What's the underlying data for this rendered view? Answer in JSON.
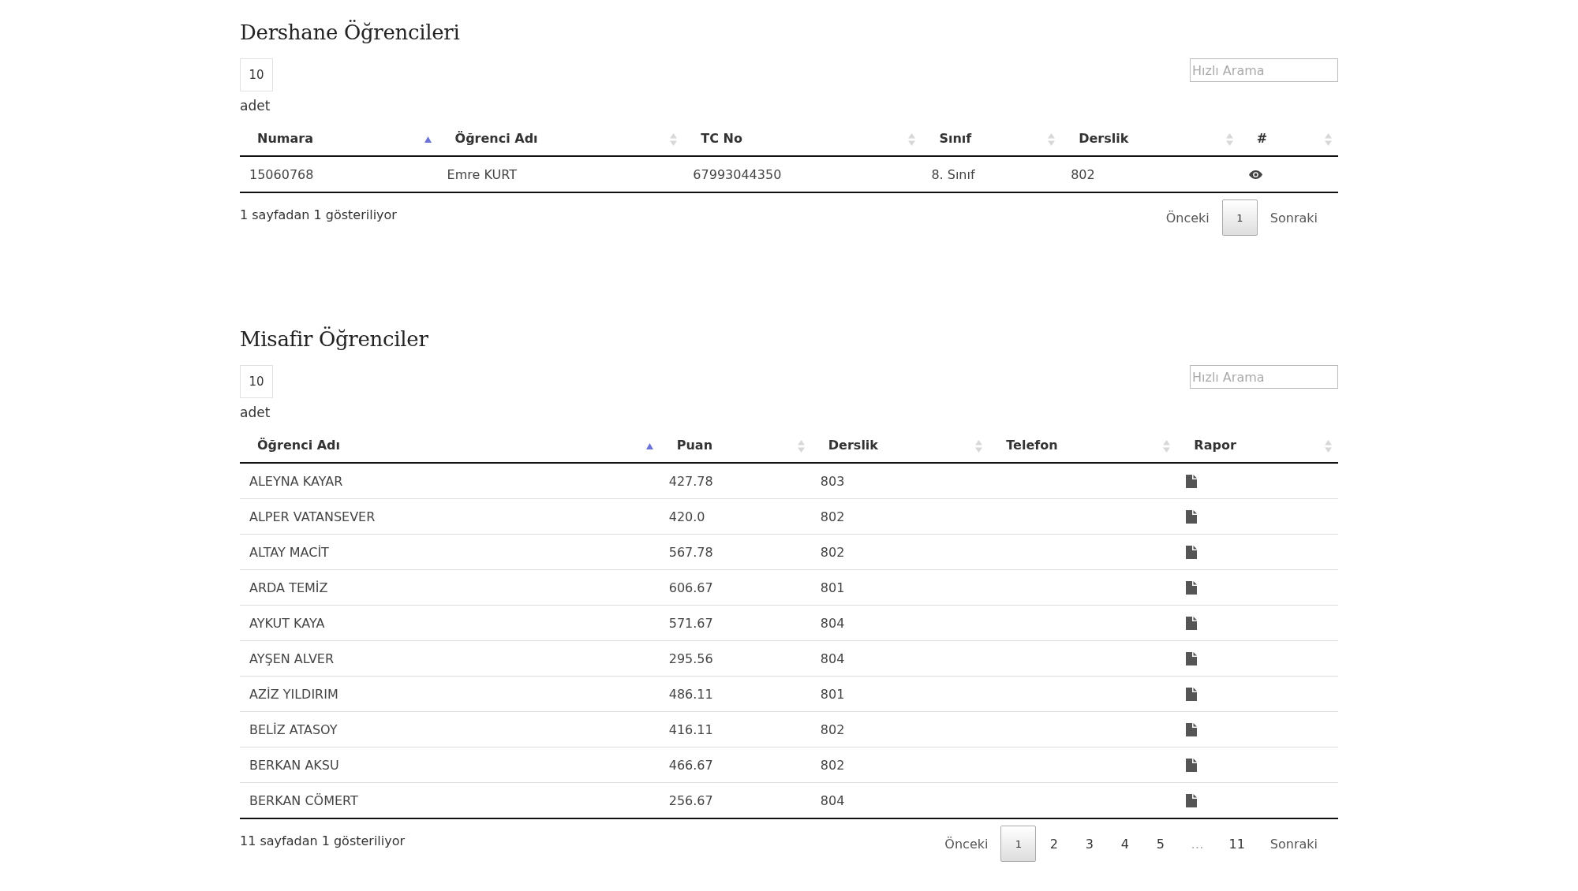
{
  "sections": [
    {
      "title": "Dershane Öğrencileri",
      "length": "10",
      "length_label": "adet",
      "search": {
        "placeholder": "Hızlı Arama"
      },
      "columns": [
        {
          "label": "Numara",
          "sorted": true
        },
        {
          "label": "Öğrenci Adı",
          "sorted": false
        },
        {
          "label": "TC No",
          "sorted": false
        },
        {
          "label": "Sınıf",
          "sorted": false
        },
        {
          "label": "Derslik",
          "sorted": false
        },
        {
          "label": "#",
          "sorted": false
        }
      ],
      "rows": [
        {
          "cells": [
            {
              "kind": "text",
              "text": "15060768"
            },
            {
              "kind": "text",
              "text": "Emre KURT"
            },
            {
              "kind": "text",
              "text": "67993044350"
            },
            {
              "kind": "text",
              "text": "8. Sınıf"
            },
            {
              "kind": "text",
              "text": "802"
            },
            {
              "kind": "eye"
            }
          ]
        }
      ],
      "info": "1 sayfadan 1 gösteriliyor",
      "pagination": [
        {
          "label": "Önceki",
          "kind": "nav",
          "selected": false
        },
        {
          "label": "1",
          "kind": "page",
          "selected": true
        },
        {
          "label": "Sonraki",
          "kind": "nav",
          "selected": false
        }
      ]
    },
    {
      "title": "Misafir Öğrenciler",
      "length": "10",
      "length_label": "adet",
      "search": {
        "placeholder": "Hızlı Arama"
      },
      "columns": [
        {
          "label": "Öğrenci Adı",
          "sorted": true
        },
        {
          "label": "Puan",
          "sorted": false
        },
        {
          "label": "Derslik",
          "sorted": false
        },
        {
          "label": "Telefon",
          "sorted": false
        },
        {
          "label": "Rapor",
          "sorted": false
        }
      ],
      "rows": [
        {
          "cells": [
            {
              "kind": "text",
              "text": "ALEYNA KAYAR"
            },
            {
              "kind": "text",
              "text": "427.78"
            },
            {
              "kind": "text",
              "text": "803"
            },
            {
              "kind": "empty"
            },
            {
              "kind": "file"
            }
          ]
        },
        {
          "cells": [
            {
              "kind": "text",
              "text": "ALPER VATANSEVER"
            },
            {
              "kind": "text",
              "text": "420.0"
            },
            {
              "kind": "text",
              "text": "802"
            },
            {
              "kind": "empty"
            },
            {
              "kind": "file"
            }
          ]
        },
        {
          "cells": [
            {
              "kind": "text",
              "text": "ALTAY MACİT"
            },
            {
              "kind": "text",
              "text": "567.78"
            },
            {
              "kind": "text",
              "text": "802"
            },
            {
              "kind": "empty"
            },
            {
              "kind": "file"
            }
          ]
        },
        {
          "cells": [
            {
              "kind": "text",
              "text": "ARDA TEMİZ"
            },
            {
              "kind": "text",
              "text": "606.67"
            },
            {
              "kind": "text",
              "text": "801"
            },
            {
              "kind": "empty"
            },
            {
              "kind": "file"
            }
          ]
        },
        {
          "cells": [
            {
              "kind": "text",
              "text": "AYKUT KAYA"
            },
            {
              "kind": "text",
              "text": "571.67"
            },
            {
              "kind": "text",
              "text": "804"
            },
            {
              "kind": "empty"
            },
            {
              "kind": "file"
            }
          ]
        },
        {
          "cells": [
            {
              "kind": "text",
              "text": "AYŞEN ALVER"
            },
            {
              "kind": "text",
              "text": "295.56"
            },
            {
              "kind": "text",
              "text": "804"
            },
            {
              "kind": "empty"
            },
            {
              "kind": "file"
            }
          ]
        },
        {
          "cells": [
            {
              "kind": "text",
              "text": "AZİZ YILDIRIM"
            },
            {
              "kind": "text",
              "text": "486.11"
            },
            {
              "kind": "text",
              "text": "801"
            },
            {
              "kind": "empty"
            },
            {
              "kind": "file"
            }
          ]
        },
        {
          "cells": [
            {
              "kind": "text",
              "text": "BELİZ ATASOY"
            },
            {
              "kind": "text",
              "text": "416.11"
            },
            {
              "kind": "text",
              "text": "802"
            },
            {
              "kind": "empty"
            },
            {
              "kind": "file"
            }
          ]
        },
        {
          "cells": [
            {
              "kind": "text",
              "text": "BERKAN AKSU"
            },
            {
              "kind": "text",
              "text": "466.67"
            },
            {
              "kind": "text",
              "text": "802"
            },
            {
              "kind": "empty"
            },
            {
              "kind": "file"
            }
          ]
        },
        {
          "cells": [
            {
              "kind": "text",
              "text": "BERKAN CÖMERT"
            },
            {
              "kind": "text",
              "text": "256.67"
            },
            {
              "kind": "text",
              "text": "804"
            },
            {
              "kind": "empty"
            },
            {
              "kind": "file"
            }
          ]
        }
      ],
      "info": "11 sayfadan 1 gösteriliyor",
      "pagination": [
        {
          "label": "Önceki",
          "kind": "nav",
          "selected": false
        },
        {
          "label": "1",
          "kind": "page",
          "selected": true
        },
        {
          "label": "2",
          "kind": "page",
          "selected": false
        },
        {
          "label": "3",
          "kind": "page",
          "selected": false
        },
        {
          "label": "4",
          "kind": "page",
          "selected": false
        },
        {
          "label": "5",
          "kind": "page",
          "selected": false
        },
        {
          "label": "…",
          "kind": "ellipsis"
        },
        {
          "label": "11",
          "kind": "page",
          "selected": false
        },
        {
          "label": "Sonraki",
          "kind": "nav",
          "selected": false
        }
      ]
    }
  ]
}
